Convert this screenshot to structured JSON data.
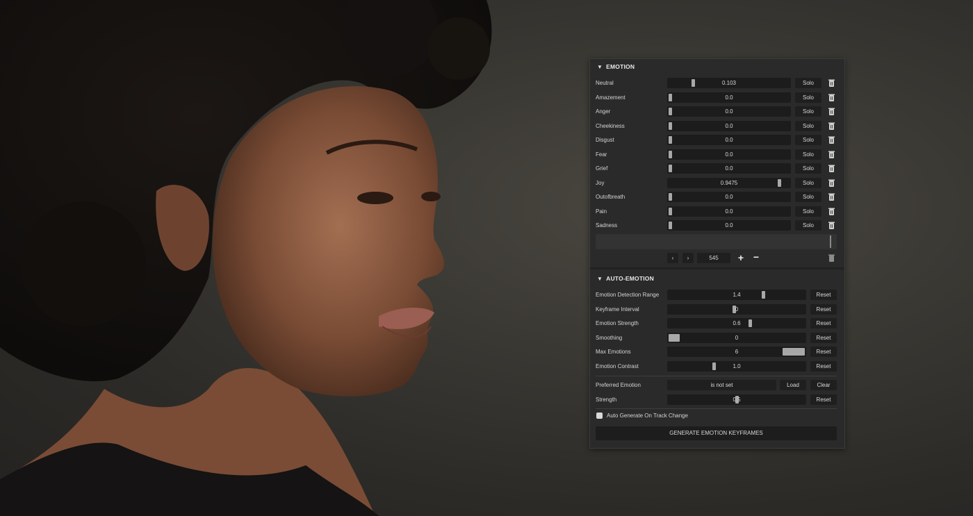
{
  "emotion_section": {
    "title": "EMOTION",
    "solo_label": "Solo",
    "rows": [
      {
        "label": "Neutral",
        "value": "0.103",
        "level": 0.103
      },
      {
        "label": "Amazement",
        "value": "0.0",
        "level": 0.0
      },
      {
        "label": "Anger",
        "value": "0.0",
        "level": 0.0
      },
      {
        "label": "Cheekiness",
        "value": "0.0",
        "level": 0.0
      },
      {
        "label": "Disgust",
        "value": "0.0",
        "level": 0.0
      },
      {
        "label": "Fear",
        "value": "0.0",
        "level": 0.0
      },
      {
        "label": "Grief",
        "value": "0.0",
        "level": 0.0
      },
      {
        "label": "Joy",
        "value": "0.9475",
        "level": 0.9475
      },
      {
        "label": "Outofbreath",
        "value": "0.0",
        "level": 0.0
      },
      {
        "label": "Pain",
        "value": "0.0",
        "level": 0.0
      },
      {
        "label": "Sadness",
        "value": "0.0",
        "level": 0.0
      }
    ],
    "frame_value": "545"
  },
  "auto_emotion_section": {
    "title": "AUTO-EMOTION",
    "reset_label": "Reset",
    "rows": [
      {
        "label": "Emotion Detection Range",
        "value": "1.4",
        "level": 0.7
      },
      {
        "label": "Keyframe Interval",
        "value": "0",
        "level": 0.48
      },
      {
        "label": "Emotion Strength",
        "value": "0.6",
        "level": 0.6
      },
      {
        "label": "Smoothing",
        "value": "0",
        "level": 0.0
      },
      {
        "label": "Max Emotions",
        "value": "6",
        "level": 1.0
      },
      {
        "label": "Emotion Contrast",
        "value": "1.0",
        "level": 0.33
      }
    ],
    "preferred": {
      "label": "Preferred Emotion",
      "value": "is not set",
      "load_label": "Load",
      "clear_label": "Clear"
    },
    "strength": {
      "label": "Strength",
      "value": "0.5",
      "level": 0.5
    },
    "auto_generate_label": "Auto Generate On Track Change",
    "auto_generate_checked": false,
    "generate_button": "GENERATE EMOTION KEYFRAMES"
  },
  "colors": {
    "panel_bg": "#2a2a2a",
    "field_bg": "#1c1c1c",
    "thumb": "#a8a8a8",
    "text": "#d6d6d6"
  }
}
